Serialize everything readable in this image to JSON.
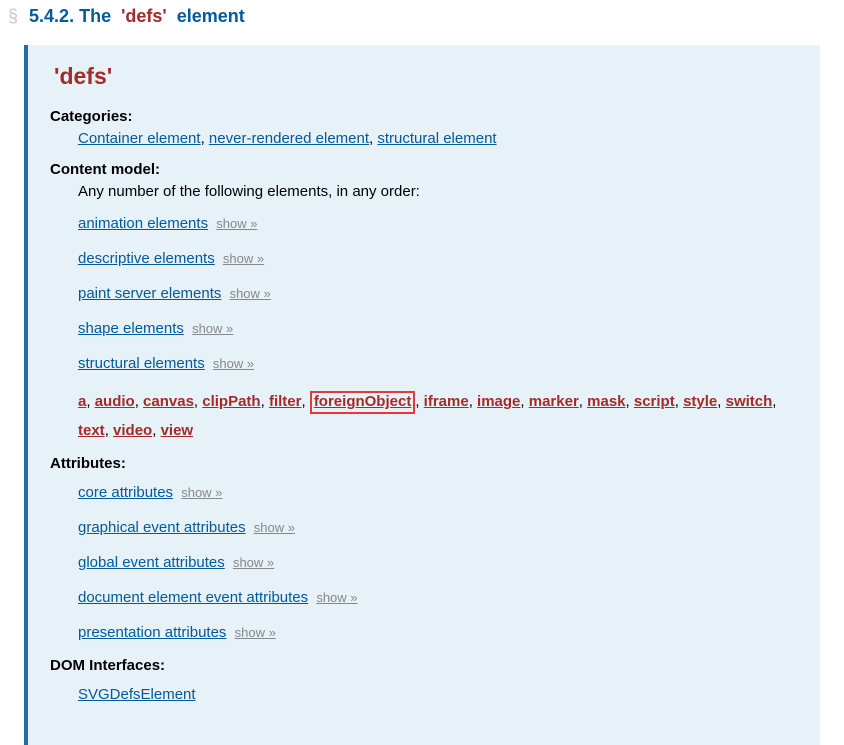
{
  "heading": {
    "anchor": "§",
    "number": "5.4.2.",
    "prefix": "The",
    "quoted": "'defs'",
    "suffix": "element"
  },
  "panel": {
    "title": "'defs'",
    "categories_label": "Categories:",
    "categories": [
      "Container element",
      "never-rendered element",
      "structural element"
    ],
    "content_model_label": "Content model:",
    "content_model_intro": "Any number of the following elements, in any order:",
    "show_label": "show »",
    "element_groups": [
      "animation elements",
      "descriptive elements",
      "paint server elements",
      "shape elements",
      "structural elements"
    ],
    "inline_elements": [
      {
        "t": "a",
        "red": true
      },
      {
        "t": "audio",
        "red": true
      },
      {
        "t": "canvas",
        "red": true
      },
      {
        "t": "clipPath",
        "red": true
      },
      {
        "t": "filter",
        "red": true
      },
      {
        "t": "foreignObject",
        "red": true,
        "hl": true
      },
      {
        "t": "iframe",
        "red": true
      },
      {
        "t": "image",
        "red": true
      },
      {
        "t": "marker",
        "red": true
      },
      {
        "t": "mask",
        "red": true
      },
      {
        "t": "script",
        "red": true
      },
      {
        "t": "style",
        "red": true
      },
      {
        "t": "switch",
        "red": true
      },
      {
        "t": "text",
        "red": true
      },
      {
        "t": "video",
        "red": true
      },
      {
        "t": "view",
        "red": true
      }
    ],
    "attributes_label": "Attributes:",
    "attribute_groups": [
      "core attributes",
      "graphical event attributes",
      "global event attributes",
      "document element event attributes",
      "presentation attributes"
    ],
    "dom_label": "DOM Interfaces:",
    "dom_interfaces": [
      "SVGDefsElement"
    ]
  }
}
